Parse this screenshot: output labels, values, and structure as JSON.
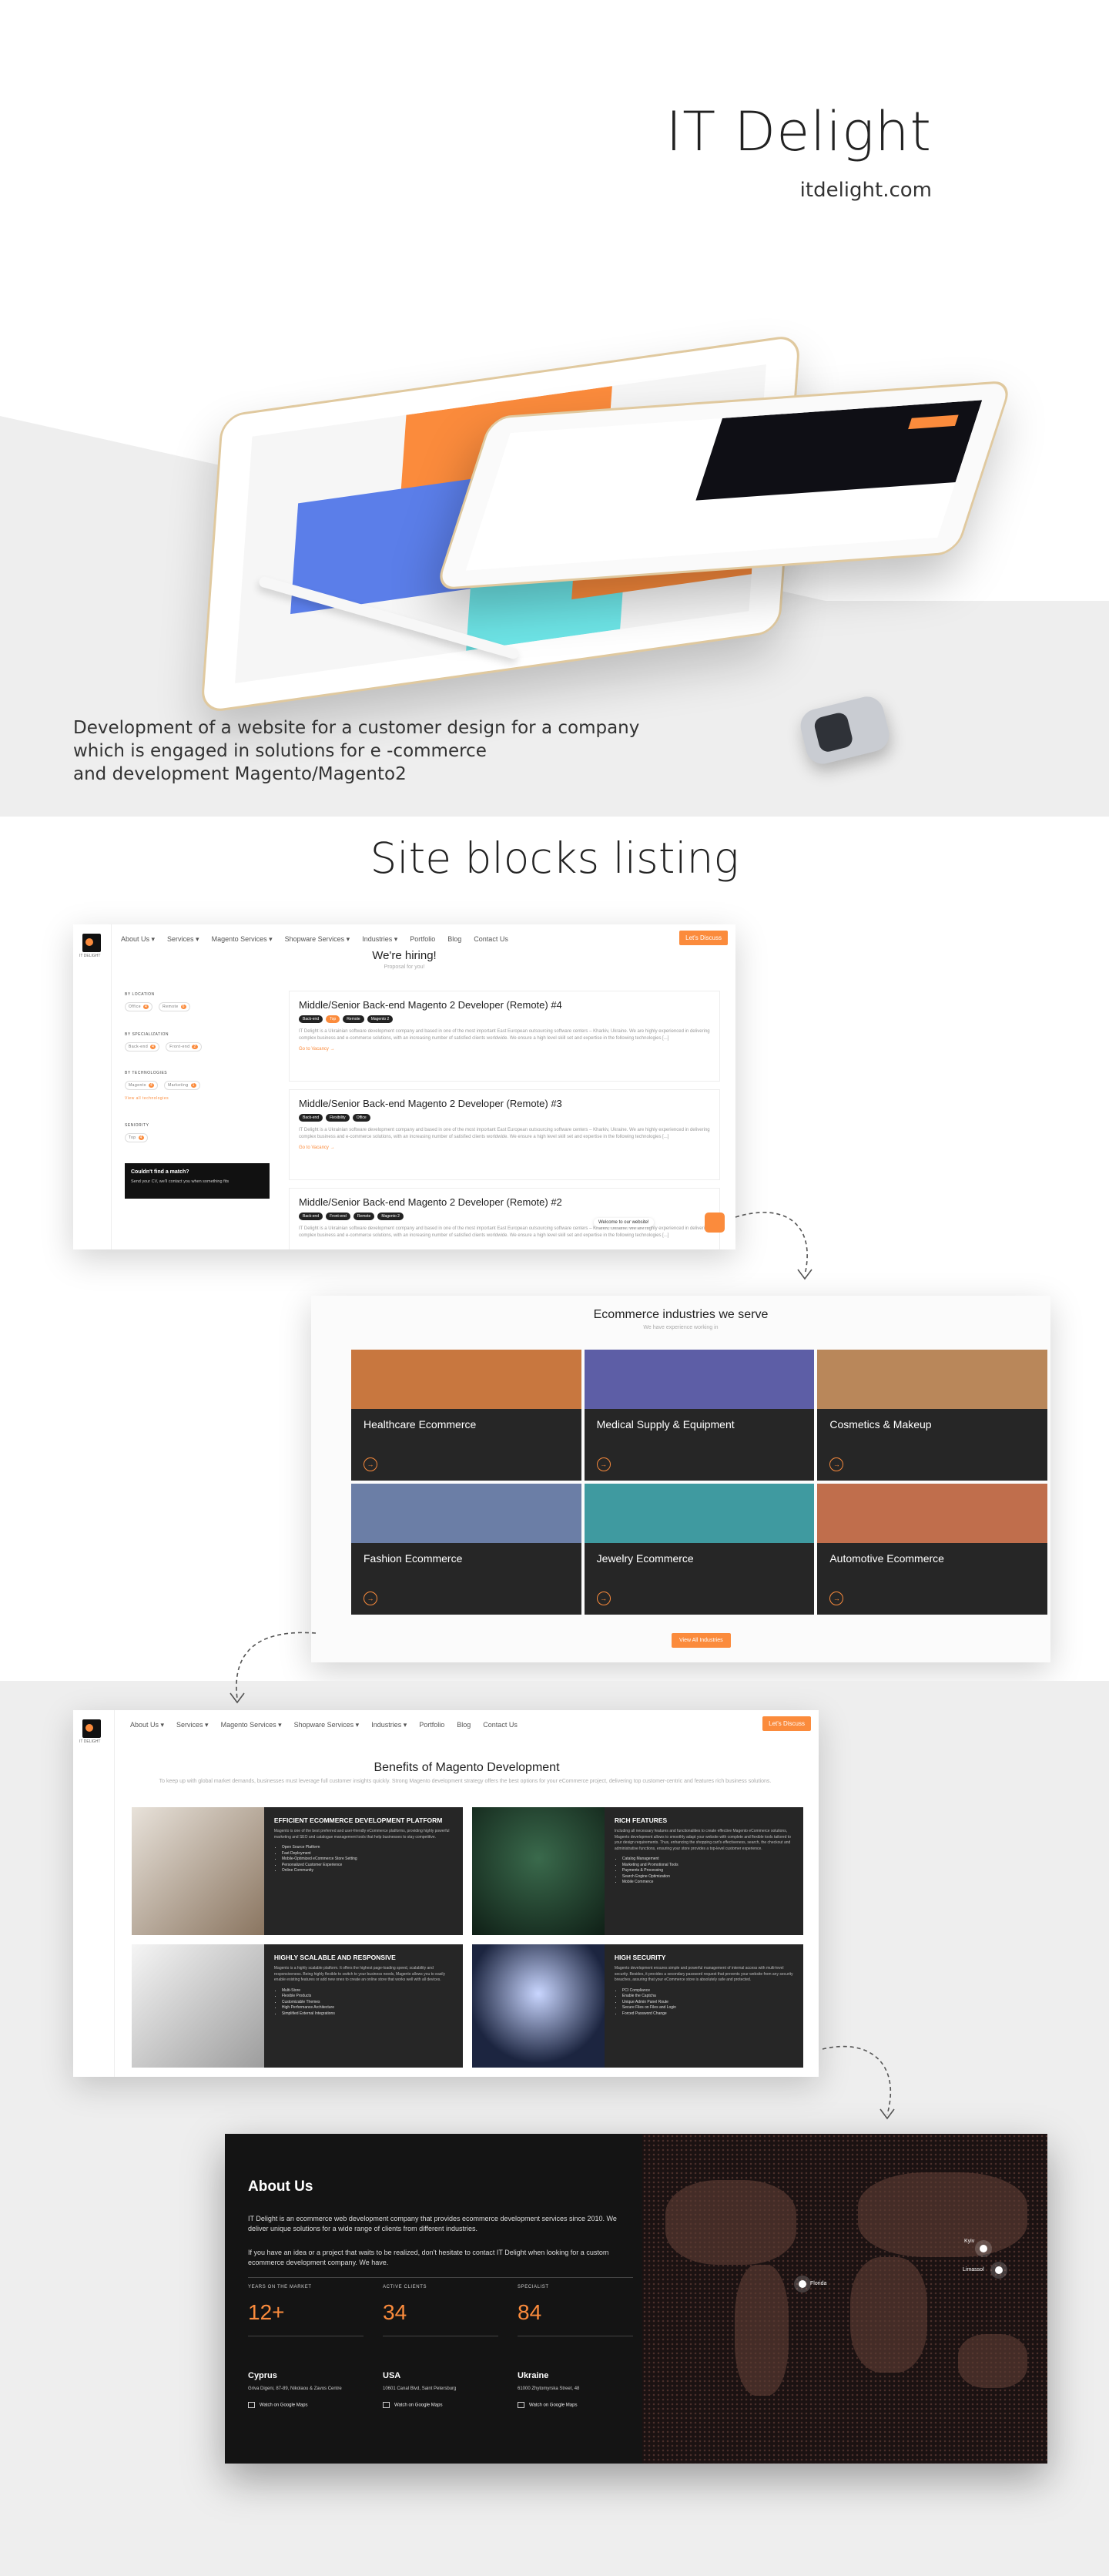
{
  "hero": {
    "title": "IT Delight",
    "domain": "itdelight.com",
    "description": [
      "Development of a website for a customer design for a company",
      "which is engaged in solutions for e -commerce",
      "and development Magento/Magento2"
    ]
  },
  "section_title": "Site blocks listing",
  "careers_block": {
    "nav": [
      "About Us ▾",
      "Services ▾",
      "Magento Services ▾",
      "Shopware Services ▾",
      "Industries ▾",
      "Portfolio",
      "Blog",
      "Contact Us"
    ],
    "cta": "Let's Discuss",
    "logo_text": "IT DELIGHT",
    "heading": "We're hiring!",
    "subheading": "Proposal for you!",
    "filters": [
      {
        "label": "BY LOCATION",
        "pills": [
          {
            "name": "Office",
            "count": "4"
          },
          {
            "name": "Remote",
            "count": "6"
          }
        ]
      },
      {
        "label": "BY SPECIALIZATION",
        "pills": [
          {
            "name": "Back-end",
            "count": "4"
          },
          {
            "name": "Front-end",
            "count": "2"
          }
        ]
      },
      {
        "label": "BY TECHNOLOGIES",
        "pills": [
          {
            "name": "Magento",
            "count": "4"
          },
          {
            "name": "Marketing",
            "count": "1"
          }
        ]
      },
      {
        "label": "SENIORITY",
        "pills": [
          {
            "name": "Top",
            "count": "4"
          }
        ]
      }
    ],
    "view_all": "View all technologies",
    "box": {
      "title": "Couldn't find a match?",
      "text": "Send your CV, we'll contact you when something fits"
    },
    "jobs": [
      {
        "title": "Middle/Senior Back-end Magento 2 Developer (Remote) #4",
        "tags": [
          "Back-end",
          "Top",
          "Remote",
          "Magento 2"
        ],
        "text": "IT Delight is a Ukrainian software development company and based in one of the most important East European outsourcing software centers – Kharkiv, Ukraine. We are highly experienced in delivering complex business and e-commerce solutions, with an increasing number of satisfied clients worldwide. We ensure a high level skill set and expertise in the following technologies [...]",
        "link": "Go to Vacancy →"
      },
      {
        "title": "Middle/Senior Back-end Magento 2 Developer (Remote) #3",
        "tags": [
          "Back-end",
          "Flexibility",
          "Office"
        ],
        "text": "IT Delight is a Ukrainian software development company and based in one of the most important East European outsourcing software centers – Kharkiv, Ukraine. We are highly experienced in delivering complex business and e-commerce solutions, with an increasing number of satisfied clients worldwide. We ensure a high level skill set and expertise in the following technologies [...]",
        "link": "Go to Vacancy →"
      },
      {
        "title": "Middle/Senior Back-end Magento 2 Developer (Remote) #2",
        "tags": [
          "Back-end",
          "Front-end",
          "Remote",
          "Magento 2"
        ],
        "text": "IT Delight is a Ukrainian software development company and based in one of the most important East European outsourcing software centers – Kharkiv, Ukraine. We are highly experienced in delivering complex business and e-commerce solutions, with an increasing number of satisfied clients worldwide. We ensure a high level skill set and expertise in the following technologies [...]",
        "link": ""
      }
    ],
    "chat": "Welcome to our website!"
  },
  "industries_block": {
    "heading": "Ecommerce industries we serve",
    "subheading": "We have experience working in",
    "items": [
      {
        "title": "Healthcare Ecommerce",
        "color": "#c8773f"
      },
      {
        "title": "Medical Supply & Equipment",
        "color": "#5d5ea6"
      },
      {
        "title": "Cosmetics & Makeup",
        "color": "#b9875a"
      },
      {
        "title": "Fashion Ecommerce",
        "color": "#6b7ea6"
      },
      {
        "title": "Jewelry Ecommerce",
        "color": "#3f9aa0"
      },
      {
        "title": "Automotive Ecommerce",
        "color": "#c06e4c"
      }
    ],
    "button": "View All Industries",
    "arrow_label": "→"
  },
  "benefits_block": {
    "nav": [
      "About Us ▾",
      "Services ▾",
      "Magento Services ▾",
      "Shopware Services ▾",
      "Industries ▾",
      "Portfolio",
      "Blog",
      "Contact Us"
    ],
    "cta": "Let's Discuss",
    "heading": "Benefits of Magento Development",
    "subheading": "To keep up with global market demands, businesses must leverage full customer insights quickly. Strong Magento development strategy offers the best options for your eCommerce project, delivering top customer-centric and features rich business solutions.",
    "cards": [
      {
        "title": "EFFICIENT ECOMMERCE DEVELOPMENT PLATFORM",
        "text": "Magento is one of the best preferred and user-friendly eCommerce platforms, providing highly powerful marketing and SEO and catalogue management tools that help businesses to stay competitive.",
        "list": [
          "Open Source Platform",
          "Fast Deployment",
          "Mobile-Optimized eCommerce Store Setting",
          "Personalized Customer Experience",
          "Online Community"
        ],
        "color": "#8a7560"
      },
      {
        "title": "RICH FEATURES",
        "text": "Including all necessary features and functionalities to create effective Magento eCommerce solutions, Magento development allows to smoothly adapt your website with complete and flexible tools tailored to your design requirements. Thus, enhancing the shopping cart's effectiveness, search, the checkout and administrative functions, ensuring your store provides a top-level customer experience.",
        "list": [
          "Catalog Management",
          "Marketing and Promotional Tools",
          "Payments & Processing",
          "Search Engine Optimization",
          "Mobile Commerce"
        ],
        "color": "#1f3b2c"
      },
      {
        "title": "HIGHLY SCALABLE AND RESPONSIVE",
        "text": "Magento is a highly scalable platform. It offers the highest page-loading speed, scalability and responsiveness. Being highly flexible to switch to your business needs, Magento allows you to easily enable existing features or add new ones to create an online store that works well with all devices.",
        "list": [
          "Multi-Store",
          "Flexible Products",
          "Customizable Themes",
          "High Performance Architecture",
          "Simplified External Integrations"
        ],
        "color": "#bdbdbd"
      },
      {
        "title": "HIGH SECURITY",
        "text": "Magento development ensures simple and powerful management of internal access with multi-level security. Besides, it provides a secondary password request that prevents your website from any security breaches, assuring that your eCommerce store is absolutely safe and protected.",
        "list": [
          "PCI Compliance",
          "Enable the Captcha",
          "Unique Admin Panel Route",
          "Secure Files on Files and Login",
          "Forced Password Change"
        ],
        "color": "#4a5a7a"
      }
    ]
  },
  "about_block": {
    "title": "About Us",
    "p1": "IT Delight is an ecommerce web development company that provides ecommerce development services since 2010. We deliver unique solutions for a wide range of clients from different industries.",
    "p2": "If you have an idea or a project that waits to be realized, don't hesitate to contact IT Delight when looking for a custom ecommerce development company. We have.",
    "stats": [
      {
        "label": "YEARS ON THE MARKET",
        "value": "12+"
      },
      {
        "label": "ACTIVE CLIENTS",
        "value": "34"
      },
      {
        "label": "SPECIALIST",
        "value": "84"
      }
    ],
    "offices": [
      {
        "name": "Cyprus",
        "address": "Griva Digeni, 87-89, Nikolaou & Zavos Centre",
        "link": "Watch on Google Maps"
      },
      {
        "name": "USA",
        "address": "10601 Canal Blvd, Saint Petersburg",
        "link": "Watch on Google Maps"
      },
      {
        "name": "Ukraine",
        "address": "61000 Zhytomyrska Street, 48",
        "link": "Watch on Google Maps"
      }
    ],
    "pins": [
      "Florida",
      "Kyiv",
      "Limassol"
    ]
  }
}
